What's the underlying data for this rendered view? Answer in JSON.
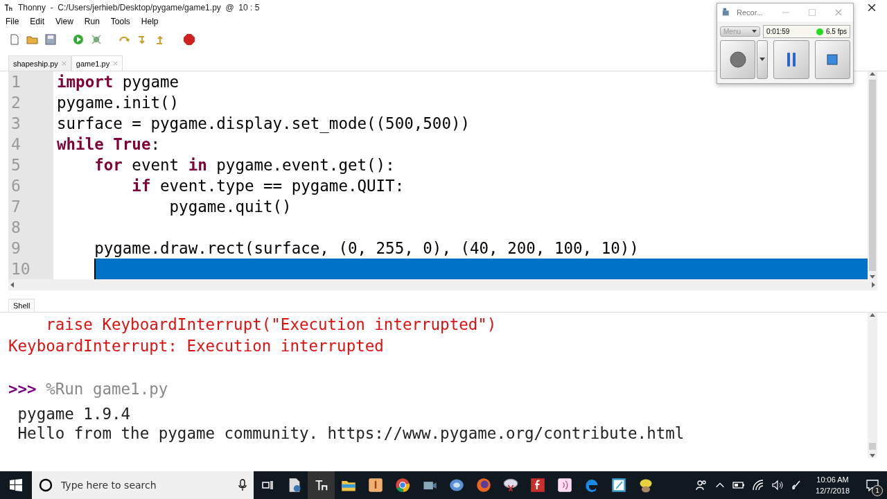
{
  "window": {
    "title": "Thonny  -  C:/Users/jerhieb/Desktop/pygame/game1.py  @  10 : 5"
  },
  "menu": [
    "File",
    "Edit",
    "View",
    "Run",
    "Tools",
    "Help"
  ],
  "editor_tabs": [
    {
      "label": "shapeship.py",
      "selected": false
    },
    {
      "label": "game1.py",
      "selected": true
    }
  ],
  "editor": {
    "lines": [
      {
        "number": "1",
        "selected": false,
        "tokens": [
          {
            "text": "import",
            "kind": "keyword"
          },
          {
            "text": " pygame",
            "kind": "plain"
          }
        ]
      },
      {
        "number": "2",
        "selected": false,
        "tokens": [
          {
            "text": "pygame.init()",
            "kind": "plain"
          }
        ]
      },
      {
        "number": "3",
        "selected": false,
        "tokens": [
          {
            "text": "surface = pygame.display.set_mode((500,500))",
            "kind": "plain"
          }
        ]
      },
      {
        "number": "4",
        "selected": false,
        "tokens": [
          {
            "text": "while",
            "kind": "keyword"
          },
          {
            "text": " True",
            "kind": "keyword"
          },
          {
            "text": ":",
            "kind": "plain"
          }
        ]
      },
      {
        "number": "5",
        "selected": false,
        "tokens": [
          {
            "text": "    for",
            "kind": "keyword"
          },
          {
            "text": " event ",
            "kind": "plain"
          },
          {
            "text": "in",
            "kind": "keyword"
          },
          {
            "text": " pygame.event.get():",
            "kind": "plain"
          }
        ]
      },
      {
        "number": "6",
        "selected": false,
        "tokens": [
          {
            "text": "        if",
            "kind": "keyword"
          },
          {
            "text": " event.type == pygame.QUIT:",
            "kind": "plain"
          }
        ]
      },
      {
        "number": "7",
        "selected": false,
        "tokens": [
          {
            "text": "            pygame.quit()",
            "kind": "plain"
          }
        ]
      },
      {
        "number": "8",
        "selected": false
      },
      {
        "number": "9",
        "selected": false,
        "tokens": [
          {
            "text": "    pygame.draw.rect(surface, (0, 255, 0), (40, 200, 100, 10))",
            "kind": "plain"
          }
        ]
      },
      {
        "number": "10",
        "selected": true
      }
    ]
  },
  "shell": {
    "tab": "Shell",
    "lines": [
      {
        "kind": "error",
        "text": "    raise KeyboardInterrupt(\"Execution interrupted\")"
      },
      {
        "kind": "error",
        "text": "KeyboardInterrupt: Execution interrupted"
      },
      {
        "kind": "blank"
      },
      {
        "kind": "command",
        "prompt": ">>>",
        "text": " %Run game1.py"
      },
      {
        "kind": "output",
        "text": " pygame 1.9.4"
      },
      {
        "kind": "output",
        "text": " Hello from the pygame community. https://www.pygame.org/contribute.html"
      }
    ]
  },
  "recorder": {
    "title": "Recor...",
    "menu": "Menu",
    "time": "0:01:59",
    "fps": "6.5 fps"
  },
  "taskbar": {
    "search": {
      "placeholder": "Type here to search"
    },
    "time": "10:06 AM",
    "date": "12/7/2018",
    "notifications": "1"
  }
}
